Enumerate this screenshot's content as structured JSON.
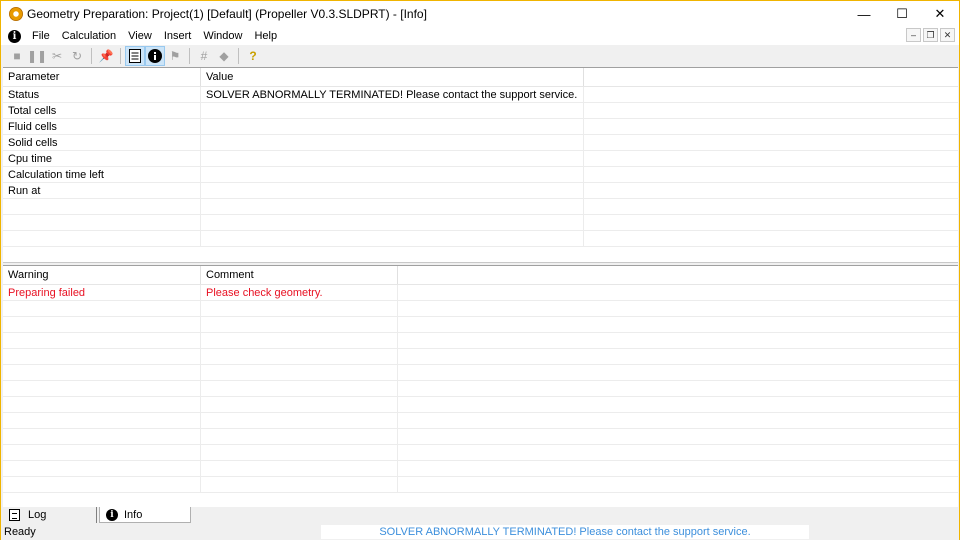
{
  "window": {
    "title": "Geometry Preparation: Project(1) [Default] (Propeller V0.3.SLDPRT) - [Info]",
    "controls": {
      "minimize": "—",
      "maximize": "☐",
      "close": "✕"
    }
  },
  "menu": {
    "items": [
      "File",
      "Calculation",
      "View",
      "Insert",
      "Window",
      "Help"
    ],
    "mdi": {
      "minimize": "–",
      "restore": "❐",
      "close": "✕"
    }
  },
  "toolbar": {
    "icons": [
      "stop-icon",
      "pause-icon",
      "cut-icon",
      "refresh-icon",
      "pin-icon",
      "log-icon",
      "info-icon",
      "flag-icon",
      "grid-icon",
      "diamond-icon",
      "help-icon"
    ]
  },
  "parameters": {
    "headers": [
      "Parameter",
      "Value"
    ],
    "rows": [
      {
        "name": "Status",
        "value": "SOLVER ABNORMALLY TERMINATED! Please contact the support service."
      },
      {
        "name": "Total cells",
        "value": ""
      },
      {
        "name": "Fluid cells",
        "value": ""
      },
      {
        "name": "Solid cells",
        "value": ""
      },
      {
        "name": "Cpu time",
        "value": ""
      },
      {
        "name": "Calculation time left",
        "value": ""
      },
      {
        "name": "Run at",
        "value": ""
      }
    ]
  },
  "warnings": {
    "headers": [
      "Warning",
      "Comment"
    ],
    "rows": [
      {
        "warning": "Preparing failed",
        "comment": "Please check geometry."
      }
    ]
  },
  "tabs": [
    {
      "label": "Log",
      "icon": "log-icon"
    },
    {
      "label": "Info",
      "icon": "info-icon"
    }
  ],
  "status": {
    "ready": "Ready",
    "message": "SOLVER ABNORMALLY TERMINATED! Please contact the support service."
  },
  "colors": {
    "error": "#e81123",
    "status_message": "#3c8fdc",
    "window_border": "#f0b400"
  }
}
